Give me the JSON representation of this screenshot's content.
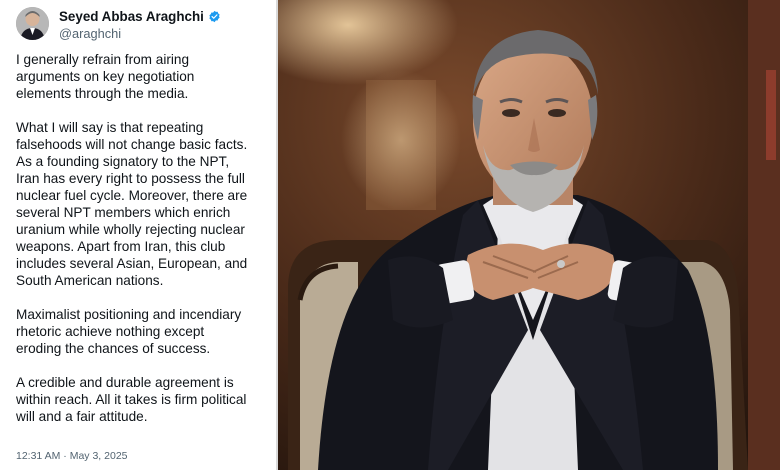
{
  "tweet": {
    "author_name": "Seyed Abbas Araghchi",
    "handle": "@araghchi",
    "verified_icon": "verified-badge-icon",
    "paragraphs": [
      "I generally refrain from airing\narguments on key negotiation\nelements through the media.",
      "What I will say is that repeating\nfalsehoods will not change basic facts.\nAs a founding signatory to the NPT,\nIran has every right to possess the full\nnuclear fuel cycle. Moreover, there are\nseveral NPT members which enrich\nuranium while wholly rejecting nuclear\nweapons. Apart from Iran, this club\nincludes several Asian, European, and\nSouth American nations.",
      "Maximalist positioning and incendiary\nrhetoric achieve nothing except\neroding the chances of success.",
      "A credible and durable agreement is\nwithin reach. All it takes is firm political\nwill and a fair attitude."
    ],
    "time": "12:31 AM",
    "separator": "·",
    "date": "May 3, 2025"
  },
  "colors": {
    "text_primary": "#0f1419",
    "text_secondary": "#536471",
    "verified_blue": "#1d9bf0"
  }
}
